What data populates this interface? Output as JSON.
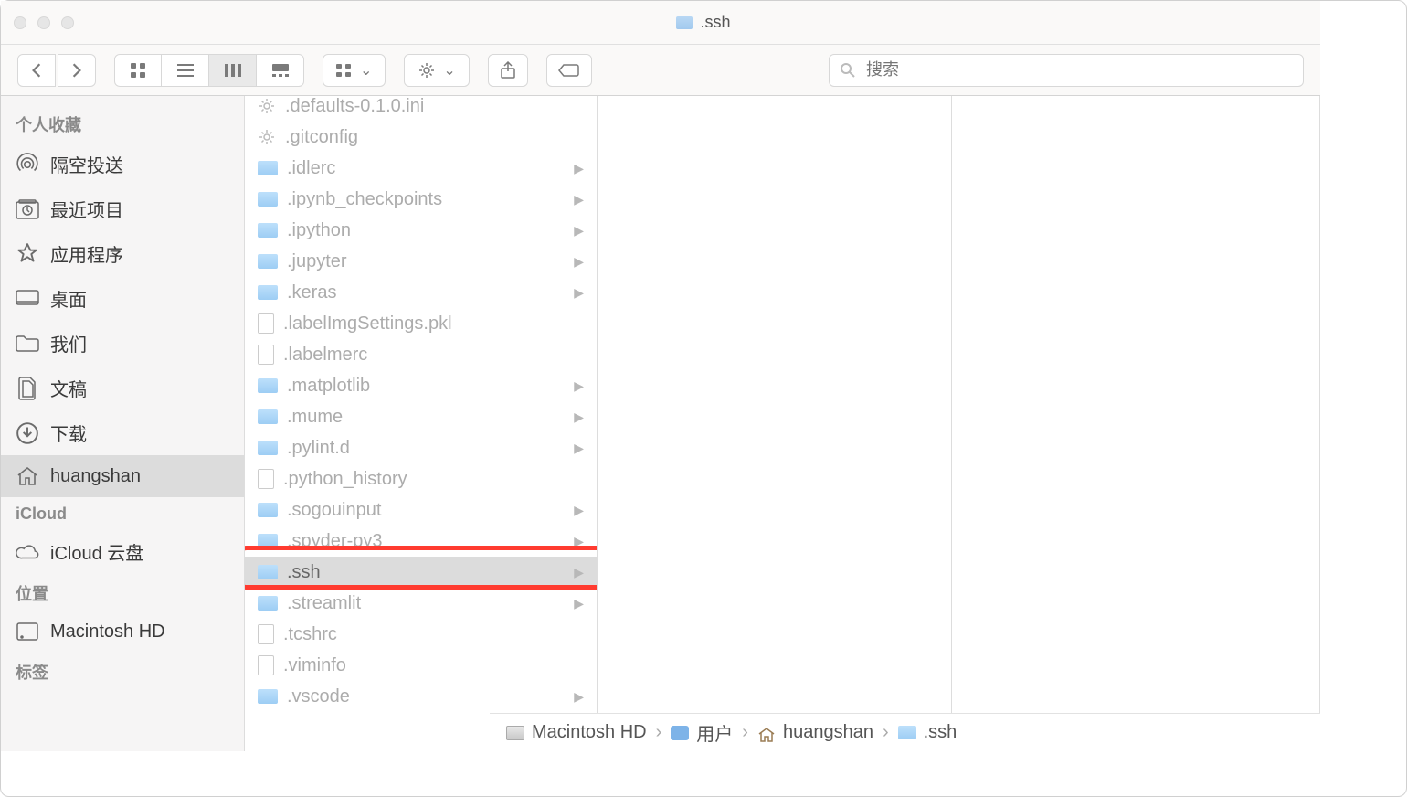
{
  "window": {
    "title": ".ssh"
  },
  "search": {
    "placeholder": "搜索"
  },
  "sidebar": {
    "sections": [
      {
        "title": "个人收藏",
        "items": [
          {
            "label": "隔空投送",
            "icon": "airdrop"
          },
          {
            "label": "最近项目",
            "icon": "recent"
          },
          {
            "label": "应用程序",
            "icon": "apps"
          },
          {
            "label": "桌面",
            "icon": "desktop"
          },
          {
            "label": "我们",
            "icon": "folder"
          },
          {
            "label": "文稿",
            "icon": "documents"
          },
          {
            "label": "下载",
            "icon": "downloads"
          },
          {
            "label": "huangshan",
            "icon": "home",
            "active": true
          }
        ]
      },
      {
        "title": "iCloud",
        "items": [
          {
            "label": "iCloud 云盘",
            "icon": "cloud"
          }
        ]
      },
      {
        "title": "位置",
        "items": [
          {
            "label": "Macintosh HD",
            "icon": "hd"
          }
        ]
      },
      {
        "title": "标签",
        "items": []
      }
    ]
  },
  "files": [
    {
      "name": ".defaults-0.1.0.ini",
      "type": "config"
    },
    {
      "name": ".gitconfig",
      "type": "config"
    },
    {
      "name": ".idlerc",
      "type": "folder"
    },
    {
      "name": ".ipynb_checkpoints",
      "type": "folder"
    },
    {
      "name": ".ipython",
      "type": "folder"
    },
    {
      "name": ".jupyter",
      "type": "folder"
    },
    {
      "name": ".keras",
      "type": "folder"
    },
    {
      "name": ".labelImgSettings.pkl",
      "type": "file"
    },
    {
      "name": ".labelmerc",
      "type": "file"
    },
    {
      "name": ".matplotlib",
      "type": "folder"
    },
    {
      "name": ".mume",
      "type": "folder"
    },
    {
      "name": ".pylint.d",
      "type": "folder"
    },
    {
      "name": ".python_history",
      "type": "file"
    },
    {
      "name": ".sogouinput",
      "type": "folder"
    },
    {
      "name": ".spyder-py3",
      "type": "folder"
    },
    {
      "name": ".ssh",
      "type": "folder",
      "selected": true,
      "highlight": true
    },
    {
      "name": ".streamlit",
      "type": "folder"
    },
    {
      "name": ".tcshrc",
      "type": "file"
    },
    {
      "name": ".viminfo",
      "type": "file"
    },
    {
      "name": ".vscode",
      "type": "folder"
    }
  ],
  "path": [
    {
      "label": "Macintosh HD",
      "icon": "hd"
    },
    {
      "label": "用户",
      "icon": "users"
    },
    {
      "label": "huangshan",
      "icon": "home"
    },
    {
      "label": ".ssh",
      "icon": "folder"
    }
  ]
}
